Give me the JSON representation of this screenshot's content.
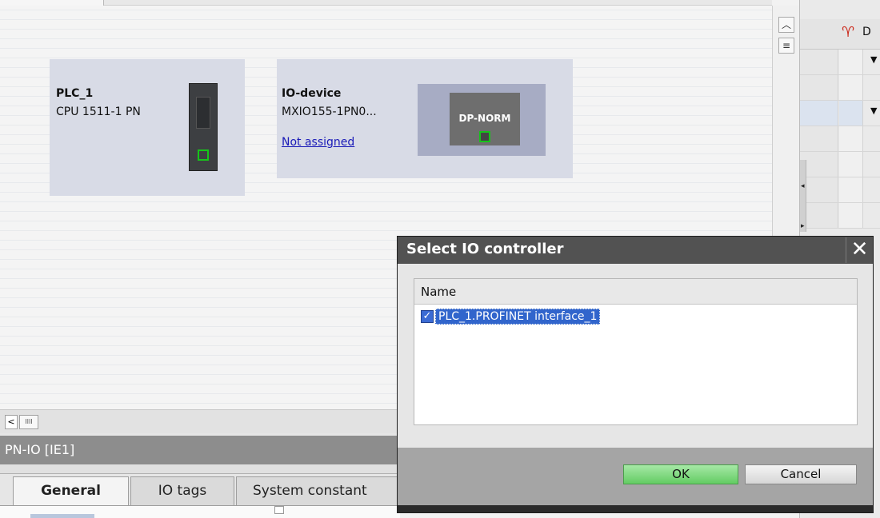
{
  "canvas": {
    "plc": {
      "name": "PLC_1",
      "type": "CPU 1511-1 PN"
    },
    "io_device": {
      "name": "IO-device",
      "type": "MXIO155-1PN0...",
      "link": "Not assigned",
      "icon_label": "DP-NORM"
    }
  },
  "right_panel": {
    "header_icon": "tag-icon",
    "header_col": "D"
  },
  "inspector": {
    "title": "PN-IO [IE1]",
    "tabs": [
      {
        "label": "General"
      },
      {
        "label": "IO tags"
      },
      {
        "label": "System constant"
      }
    ]
  },
  "dialog": {
    "title": "Select IO controller",
    "close_glyph": "✕",
    "list_header": "Name",
    "items": [
      {
        "label": "PLC_1.PROFINET interface_1",
        "checked": true
      }
    ],
    "ok_label": "OK",
    "cancel_label": "Cancel"
  },
  "scroll": {
    "thumb_glyph": "IIII",
    "left_glyph": "<"
  },
  "colors": {
    "dialog_title": "#525252",
    "ok_button": "#63cc63",
    "selection": "#3165cc",
    "link": "#1a1ab8"
  }
}
